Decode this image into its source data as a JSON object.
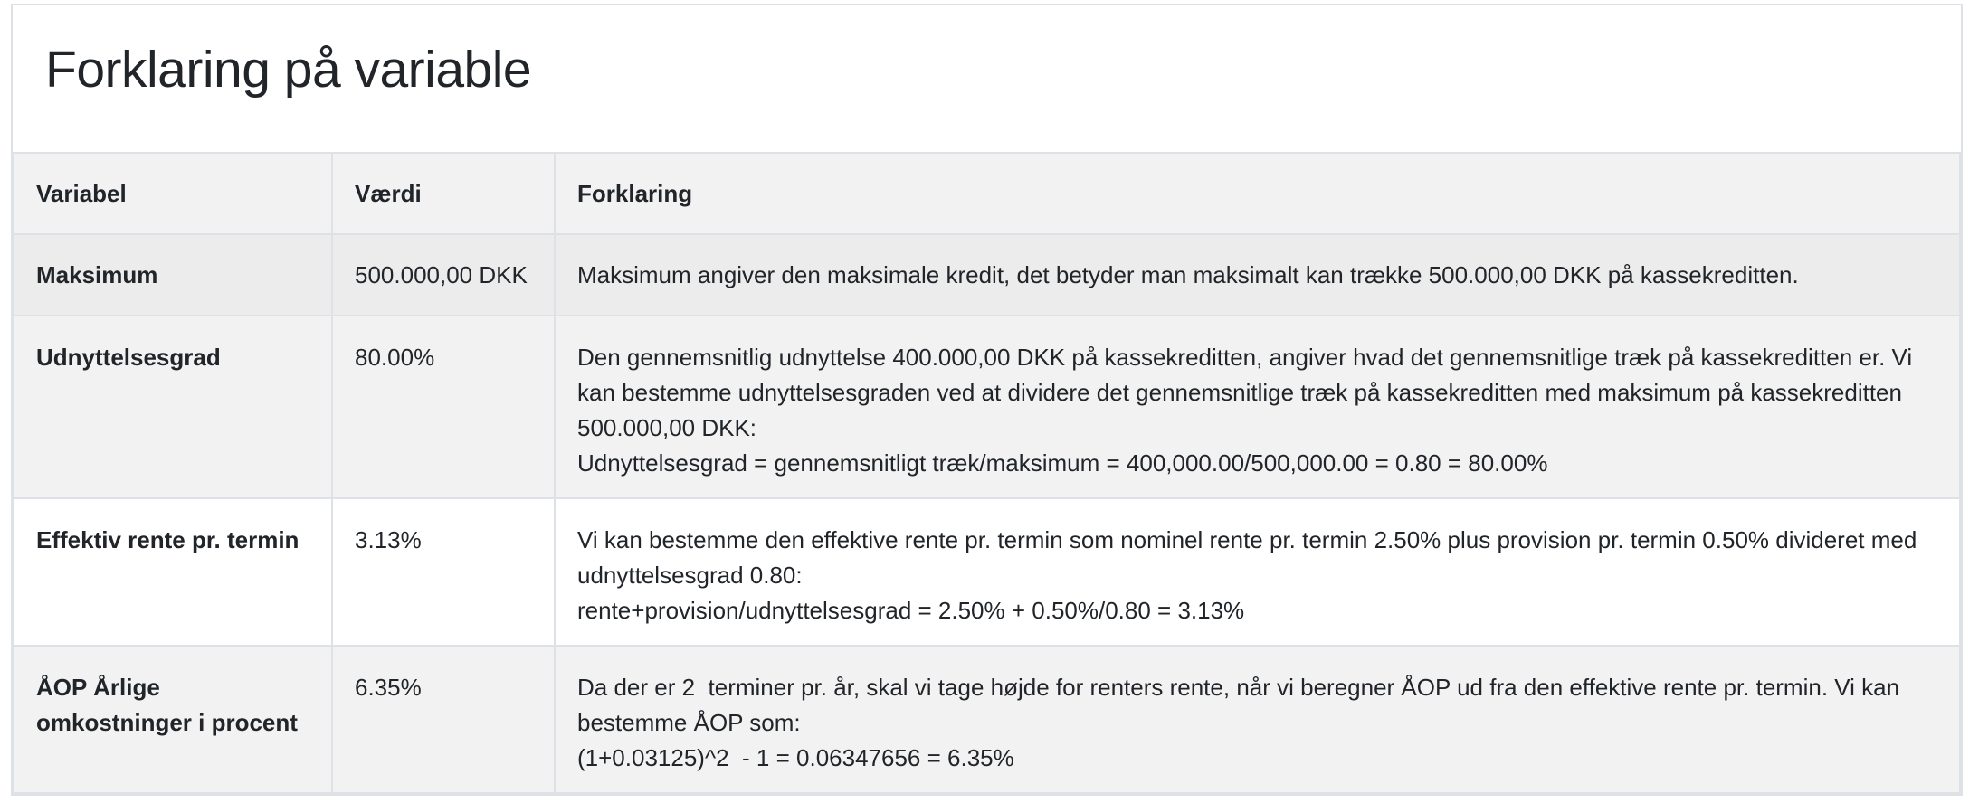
{
  "title": "Forklaring på variable",
  "table": {
    "headers": [
      "Variabel",
      "Værdi",
      "Forklaring"
    ],
    "rows": [
      {
        "variable": "Maksimum",
        "value": "500.000,00 DKK",
        "lines": [
          "Maksimum angiver den maksimale kredit, det betyder man maksimalt kan trække 500.000,00 DKK på kassekreditten."
        ]
      },
      {
        "variable": "Udnyttelsesgrad",
        "value": "80.00%",
        "lines": [
          "Den gennemsnitlig udnyttelse 400.000,00 DKK på kassekreditten, angiver hvad det gennemsnitlige træk på kassekreditten er. Vi kan bestemme udnyttelsesgraden ved at dividere det gennemsnitlige træk på kassekreditten med maksimum på kassekreditten 500.000,00 DKK:",
          "Udnyttelsesgrad = gennemsnitligt træk/maksimum = 400,000.00/500,000.00 = 0.80 = 80.00%"
        ]
      },
      {
        "variable": "Effektiv rente pr. termin",
        "value": "3.13%",
        "lines": [
          "Vi kan bestemme den effektive rente pr. termin som nominel rente pr. termin 2.50% plus provision pr. termin 0.50% divideret med udnyttelsesgrad 0.80:",
          "rente+provision/udnyttelsesgrad = 2.50% + 0.50%/0.80 = 3.13%"
        ]
      },
      {
        "variable": "ÅOP Årlige omkostninger i procent",
        "value": "6.35%",
        "lines": [
          "Da der er 2  terminer pr. år, skal vi tage højde for renters rente, når vi beregner ÅOP ud fra den effektive rente pr. termin. Vi kan bestemme ÅOP som:",
          "(1+0.03125)^2  - 1 = 0.06347656 = 6.35%"
        ]
      }
    ]
  }
}
